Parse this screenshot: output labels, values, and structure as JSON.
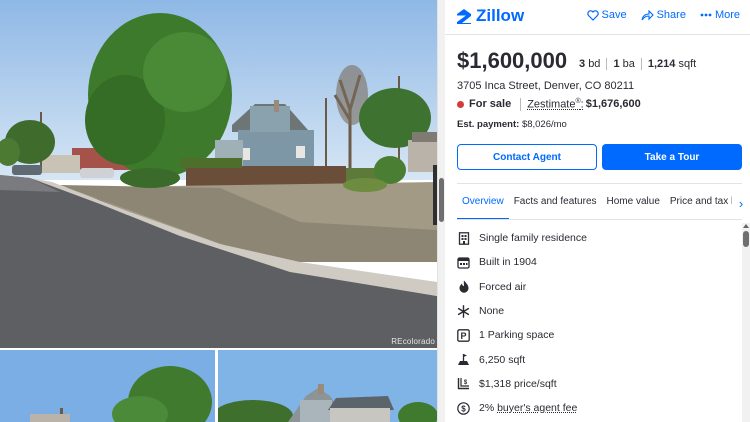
{
  "header": {
    "logo_text": "Zillow",
    "actions": {
      "save": "Save",
      "share": "Share",
      "more": "More"
    }
  },
  "photos": {
    "credit": "REcolorado"
  },
  "listing": {
    "price": "$1,600,000",
    "beds_value": "3",
    "beds_unit": "bd",
    "baths_value": "1",
    "baths_unit": "ba",
    "sqft_value": "1,214",
    "sqft_unit": "sqft",
    "address": "3705 Inca Street, Denver, CO 80211",
    "status": "For sale",
    "zestimate_label": "Zestimate",
    "zestimate_sup": "®",
    "zestimate_value": "$1,676,600",
    "est_payment_label": "Est. payment:",
    "est_payment_value": "$8,026/mo"
  },
  "buttons": {
    "contact": "Contact Agent",
    "tour": "Take a Tour"
  },
  "tabs": [
    {
      "label": "Overview",
      "active": true
    },
    {
      "label": "Facts and features",
      "active": false
    },
    {
      "label": "Home value",
      "active": false
    },
    {
      "label": "Price and tax history",
      "active": false
    }
  ],
  "features": [
    {
      "icon": "building-icon",
      "text": "Single family residence"
    },
    {
      "icon": "calendar-icon",
      "text": "Built in 1904"
    },
    {
      "icon": "flame-icon",
      "text": "Forced air"
    },
    {
      "icon": "snowflake-icon",
      "text": "None"
    },
    {
      "icon": "parking-icon",
      "text": "1 Parking space"
    },
    {
      "icon": "lot-icon",
      "text": "6,250 sqft"
    },
    {
      "icon": "price-per-sqft-icon",
      "text": "$1,318 price/sqft"
    },
    {
      "icon": "dollar-icon",
      "text_prefix": "2% ",
      "text_link": "buyer's agent fee"
    }
  ],
  "colors": {
    "brand": "#006aff",
    "text": "#2a2a33",
    "for_sale_dot": "#d53b3b"
  }
}
